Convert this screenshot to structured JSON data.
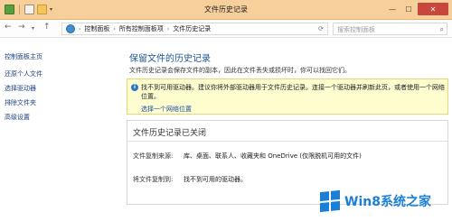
{
  "window": {
    "title": "文件历史记录",
    "controls": [
      "minimize",
      "maximize",
      "close"
    ]
  },
  "navigation": {
    "breadcrumbs": [
      "控制面板",
      "所有控制面板项",
      "文件历史记录"
    ],
    "search_placeholder": "搜索控制面板"
  },
  "sidebar": {
    "items": [
      {
        "label": "控制面板主页"
      },
      {
        "label": "还原个人文件"
      },
      {
        "label": "选择驱动器"
      },
      {
        "label": "排除文件夹"
      },
      {
        "label": "高级设置"
      }
    ]
  },
  "main": {
    "heading": "保留文件的历史记录",
    "description": "文件历史记录会保存文件的副本，因此在文件丢失或损坏时，你可以找回它们。",
    "warning": {
      "text": "找不到可用驱动器。建议你将外部驱动器用于文件历史记录。连接一个驱动器并刷新此页，或者使用一个网络位置。",
      "link": "选择一个网络位置"
    },
    "status_panel": {
      "title": "文件历史记录已关闭",
      "rows": [
        {
          "label": "文件复制来源:",
          "value": "库、桌面、联系人、收藏夹和 OneDrive (仅限脱机可用的文件)"
        },
        {
          "label": "将文件复制到:",
          "value": "找不到可用的驱动器。"
        }
      ]
    }
  },
  "watermark": {
    "text": "Win8系统之家"
  },
  "colors": {
    "titlebar": "#f7cf9a",
    "close_button": "#c9463d",
    "link": "#1c3f80",
    "heading": "#1c5696",
    "warning_bg": "#fdfdd0",
    "watermark": "#1b7fd6"
  }
}
